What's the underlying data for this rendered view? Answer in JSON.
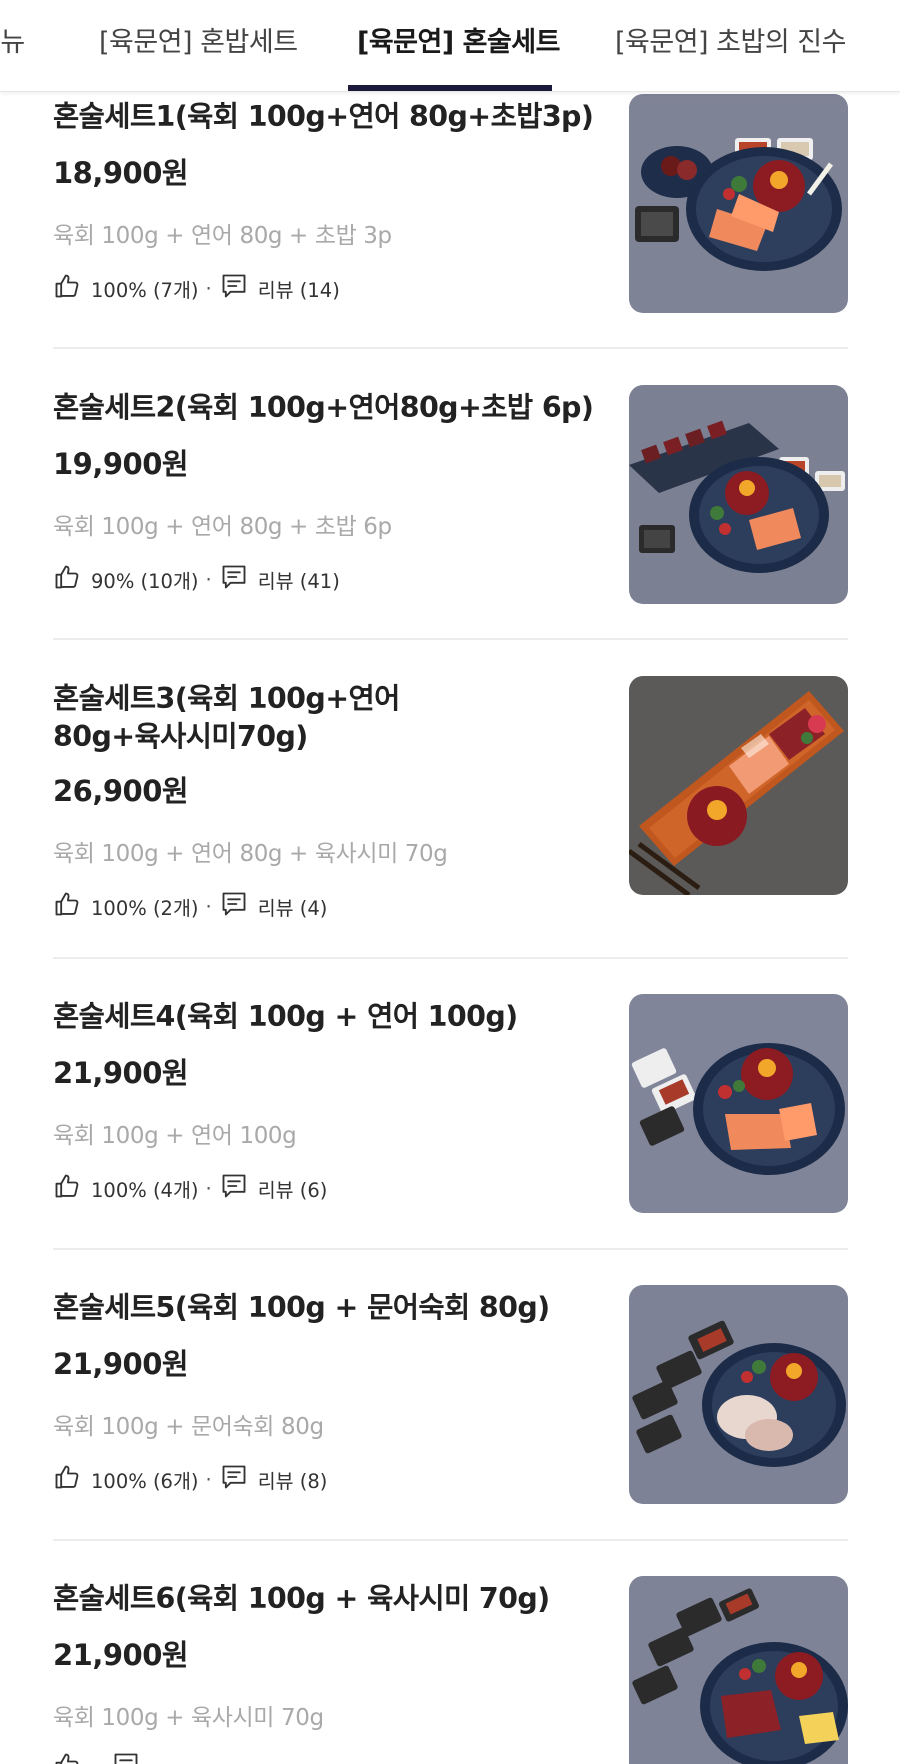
{
  "tabs": [
    {
      "label": "메뉴"
    },
    {
      "label": "[육문연] 혼밥세트"
    },
    {
      "label": "[육문연] 혼술세트"
    },
    {
      "label": "[육문연] 초밥의 진수"
    }
  ],
  "items": [
    {
      "title": "혼술세트1(육회 100g+연어 80g+초밥3p)",
      "price": "18,900원",
      "desc": "육회 100g + 연어 80g + 초밥 3p",
      "likes": "100% (7개)",
      "reviews": "리뷰 (14)",
      "image": "yukhoe-salmon-sushi-set-photo"
    },
    {
      "title": "혼술세트2(육회 100g+연어80g+초밥 6p)",
      "price": "19,900원",
      "desc": "육회 100g + 연어 80g + 초밥 6p",
      "likes": "90% (10개)",
      "reviews": "리뷰 (41)",
      "image": "yukhoe-salmon-sushi-platter-photo"
    },
    {
      "title": "혼술세트3(육회 100g+연어80g+육사시미70g)",
      "price": "26,900원",
      "desc": "육회 100g + 연어 80g + 육사시미 70g",
      "likes": "100% (2개)",
      "reviews": "리뷰 (4)",
      "image": "wooden-board-yukhoe-photo"
    },
    {
      "title": " 혼술세트4(육회 100g + 연어 100g)",
      "price": "21,900원",
      "desc": "육회 100g + 연어 100g",
      "likes": "100% (4개)",
      "reviews": "리뷰 (6)",
      "image": "yukhoe-salmon-plate-photo"
    },
    {
      "title": " 혼술세트5(육회 100g + 문어숙회 80g)",
      "price": "21,900원",
      "desc": "육회 100g + 문어숙회 80g",
      "likes": "100% (6개)",
      "reviews": "리뷰 (8)",
      "image": "yukhoe-octopus-plate-photo"
    },
    {
      "title": "혼술세트6(육회 100g + 육사시미 70g)",
      "price": "21,900원",
      "desc": "육회 100g + 육사시미 70g",
      "likes": "",
      "reviews": "",
      "image": "yukhoe-beef-sashimi-plate-photo"
    }
  ],
  "meta_separator": "·",
  "icons": {
    "like": "thumbs-up-icon",
    "review": "chat-icon"
  },
  "colors": {
    "tab_indicator": "#1c1a3a",
    "desc_text": "#a9a9a9",
    "divider": "#ececec"
  }
}
